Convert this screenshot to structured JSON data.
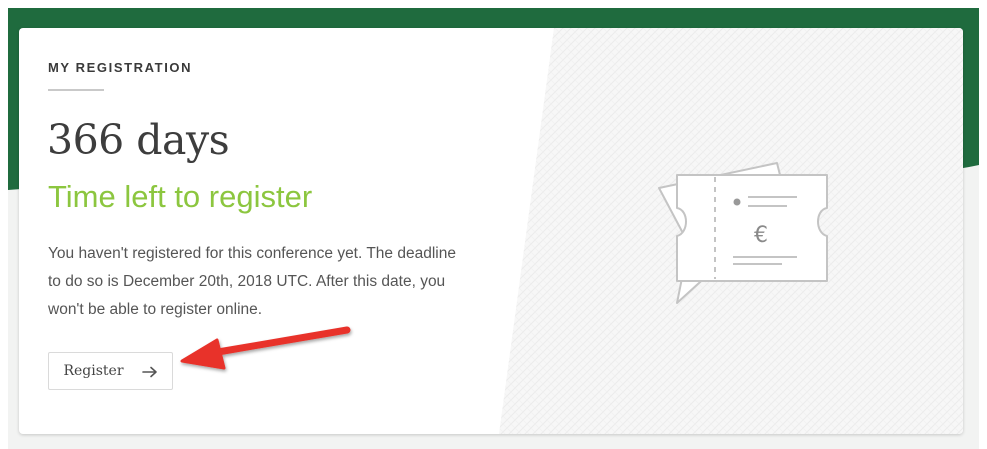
{
  "registration": {
    "section_title": "MY REGISTRATION",
    "days_left": "366 days",
    "subtitle": "Time left to register",
    "description": "You haven't registered for this conference yet. The deadline to do so is December 20th, 2018 UTC. After this date, you won't be able to register online.",
    "register_label": "Register",
    "register_icon": "arrow-right-icon",
    "ticket_currency": "€"
  },
  "colors": {
    "header_green": "#1f6b3e",
    "accent_green": "#8cc63f",
    "annotation_red": "#e8322a"
  }
}
